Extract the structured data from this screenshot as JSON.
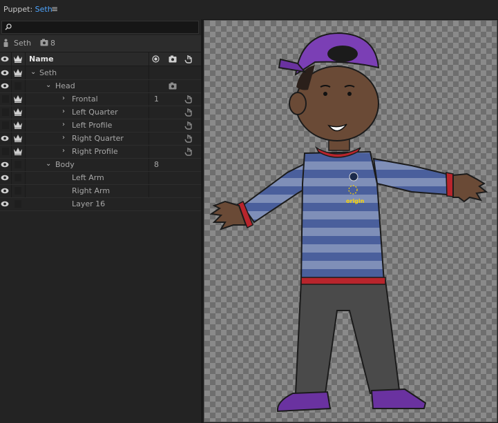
{
  "title": {
    "prefix": "Puppet:",
    "name": "Seth",
    "menu_icon": "hamburger-menu-icon"
  },
  "search": {
    "icon": "search-icon",
    "value": ""
  },
  "breadcrumb": {
    "puppet_name": "Seth",
    "count": "8"
  },
  "header": {
    "name": "Name"
  },
  "rows": [
    {
      "label": "Seth",
      "num": ""
    },
    {
      "label": "Head",
      "num": ""
    },
    {
      "label": "Frontal",
      "num": "1"
    },
    {
      "label": "Left Quarter",
      "num": ""
    },
    {
      "label": "Left Profile",
      "num": ""
    },
    {
      "label": "Right Quarter",
      "num": ""
    },
    {
      "label": "Right Profile",
      "num": ""
    },
    {
      "label": "Body",
      "num": "8"
    },
    {
      "label": "Left Arm",
      "num": ""
    },
    {
      "label": "Right Arm",
      "num": ""
    },
    {
      "label": "Layer 16",
      "num": ""
    }
  ],
  "canvas": {
    "origin_label": "origin"
  },
  "colors": {
    "accent": "#4ea5ff",
    "origin": "#ffd800",
    "shirt_stripe": "#4a5f9c",
    "cap": "#7b3fb5"
  }
}
